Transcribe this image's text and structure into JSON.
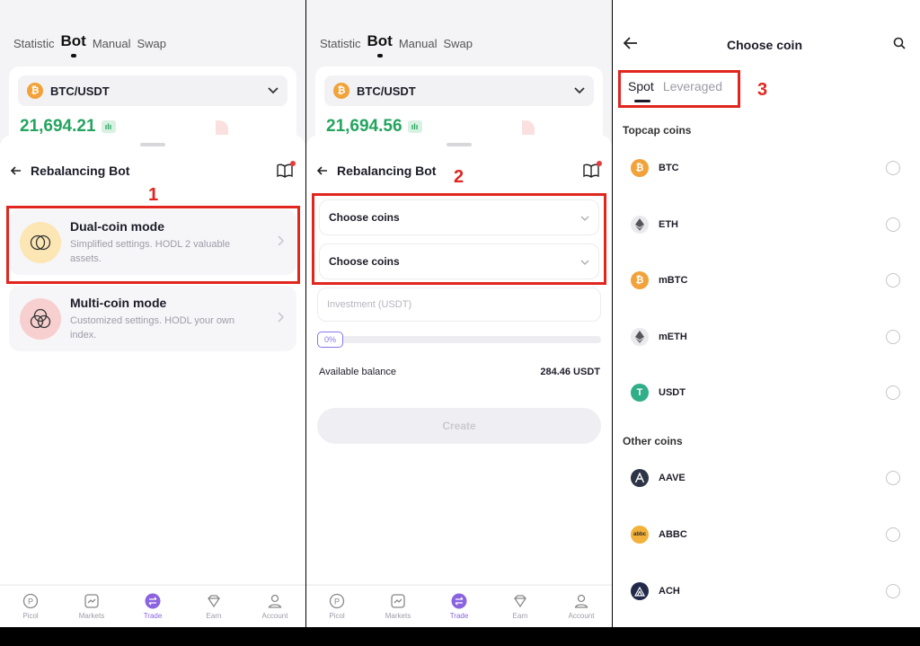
{
  "panel1": {
    "top_tabs": [
      "Statistic",
      "Bot",
      "Manual",
      "Swap"
    ],
    "pair": "BTC/USDT",
    "price": "21,694.21",
    "sheet_title": "Rebalancing Bot",
    "modes": [
      {
        "title": "Dual-coin mode",
        "desc": "Simplified settings. HODL 2 valuable assets."
      },
      {
        "title": "Multi-coin mode",
        "desc": "Customized settings. HODL your own index."
      }
    ],
    "annotation": "1"
  },
  "panel2": {
    "top_tabs": [
      "Statistic",
      "Bot",
      "Manual",
      "Swap"
    ],
    "pair": "BTC/USDT",
    "price": "21,694.56",
    "sheet_title": "Rebalancing Bot",
    "choose_coins_1": "Choose coins",
    "choose_coins_2": "Choose coins",
    "investment_placeholder": "Investment (USDT)",
    "slider_percent": "0%",
    "available_label": "Available balance",
    "available_value": "284.46 USDT",
    "create_label": "Create",
    "annotation": "2"
  },
  "bottom_nav": [
    "Picol",
    "Markets",
    "Trade",
    "Earn",
    "Account"
  ],
  "panel3": {
    "title": "Choose coin",
    "tabs": [
      "Spot",
      "Leveraged"
    ],
    "topcap_title": "Topcap coins",
    "other_title": "Other coins",
    "topcap_coins": [
      "BTC",
      "ETH",
      "mBTC",
      "mETH",
      "USDT"
    ],
    "other_coins": [
      "AAVE",
      "ABBC",
      "ACH"
    ],
    "coin_icons": [
      "btc-icon",
      "eth-icon",
      "btc-icon",
      "eth-icon",
      "usdt-icon",
      "aave-icon",
      "abbc-icon",
      "ach-icon"
    ],
    "abbc_logo_text": "abbc",
    "annotation": "3"
  },
  "colors": {
    "annotation_red": "#e0261f",
    "price_green": "#24a45f",
    "accent_purple": "#8a63e0",
    "btc_orange": "#f2a23a"
  }
}
